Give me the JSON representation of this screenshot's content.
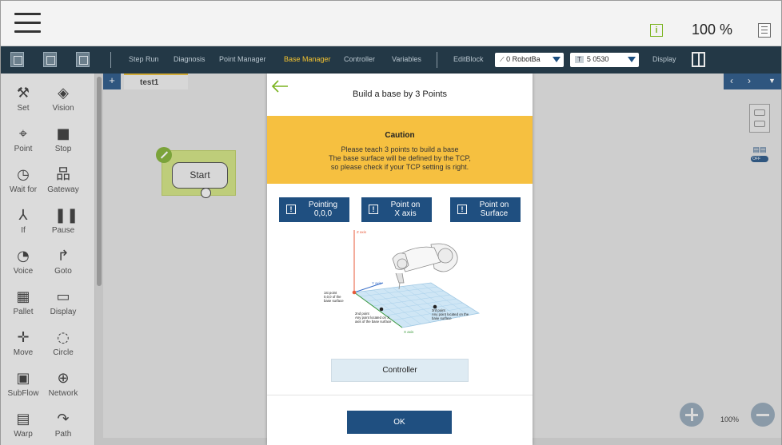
{
  "topbar": {
    "speed": "100 %",
    "info_icon_text": "i",
    "colors": {
      "info": "#7bb420",
      "toolbar": "#233846",
      "active_tab": "#f2c230",
      "accent": "#1f4f80",
      "caution": "#f6c040"
    }
  },
  "toolbar": {
    "tabs": [
      "Step Run",
      "Diagnosis",
      "Point Manager",
      "Base Manager",
      "Controller",
      "Variables"
    ],
    "active_tab": "Base Manager",
    "editblock": "EditBlock",
    "base_select": "0 RobotBa",
    "tool_badge": "T",
    "tool_select": "5 0530",
    "display": "Display"
  },
  "palette": {
    "items": [
      {
        "label": "Set",
        "icon": "wrench-icon"
      },
      {
        "label": "Vision",
        "icon": "eye-icon"
      },
      {
        "label": "Point",
        "icon": "point-icon"
      },
      {
        "label": "Stop",
        "icon": "stop-icon"
      },
      {
        "label": "Wait for",
        "icon": "clock-icon"
      },
      {
        "label": "Gateway",
        "icon": "gateway-icon"
      },
      {
        "label": "If",
        "icon": "branch-icon"
      },
      {
        "label": "Pause",
        "icon": "pause-icon"
      },
      {
        "label": "Voice",
        "icon": "voice-icon"
      },
      {
        "label": "Goto",
        "icon": "goto-icon"
      },
      {
        "label": "Pallet",
        "icon": "pallet-icon"
      },
      {
        "label": "Display",
        "icon": "display-icon"
      },
      {
        "label": "Move",
        "icon": "move-icon"
      },
      {
        "label": "Circle",
        "icon": "circle-icon"
      },
      {
        "label": "SubFlow",
        "icon": "subflow-icon"
      },
      {
        "label": "Network",
        "icon": "network-icon"
      },
      {
        "label": "Warp",
        "icon": "warp-icon"
      },
      {
        "label": "Path",
        "icon": "path-icon"
      }
    ]
  },
  "canvas": {
    "add_tab": "+",
    "tab_name": "test1",
    "start_node": "Start",
    "toggle_label": "OFF",
    "zoom": "100%"
  },
  "dialog": {
    "title": "Build a base by 3 Points",
    "caution_title": "Caution",
    "caution_lines": [
      "Please teach 3 points to build a base",
      "The base surface will be defined by the TCP,",
      "so please check if your TCP setting is right."
    ],
    "steps": [
      {
        "line1": "Pointing",
        "line2": "0,0,0"
      },
      {
        "line1": "Point on",
        "line2": "X axis"
      },
      {
        "line1": "Point on",
        "line2": "Surface"
      }
    ],
    "step_icon_text": "!",
    "illustration": {
      "z_axis": "Z axis",
      "y_axis": "Y axis",
      "x_axis": "X axis",
      "p1_lines": [
        "1st point",
        "0,0,0 of the",
        "base surface"
      ],
      "p2_lines": [
        "2nd point",
        "Any point located on X",
        "axis of the base surface"
      ],
      "p3_lines": [
        "3rd point",
        "Any point located on the",
        "base surface"
      ]
    },
    "controller_button": "Controller",
    "ok_button": "OK"
  }
}
